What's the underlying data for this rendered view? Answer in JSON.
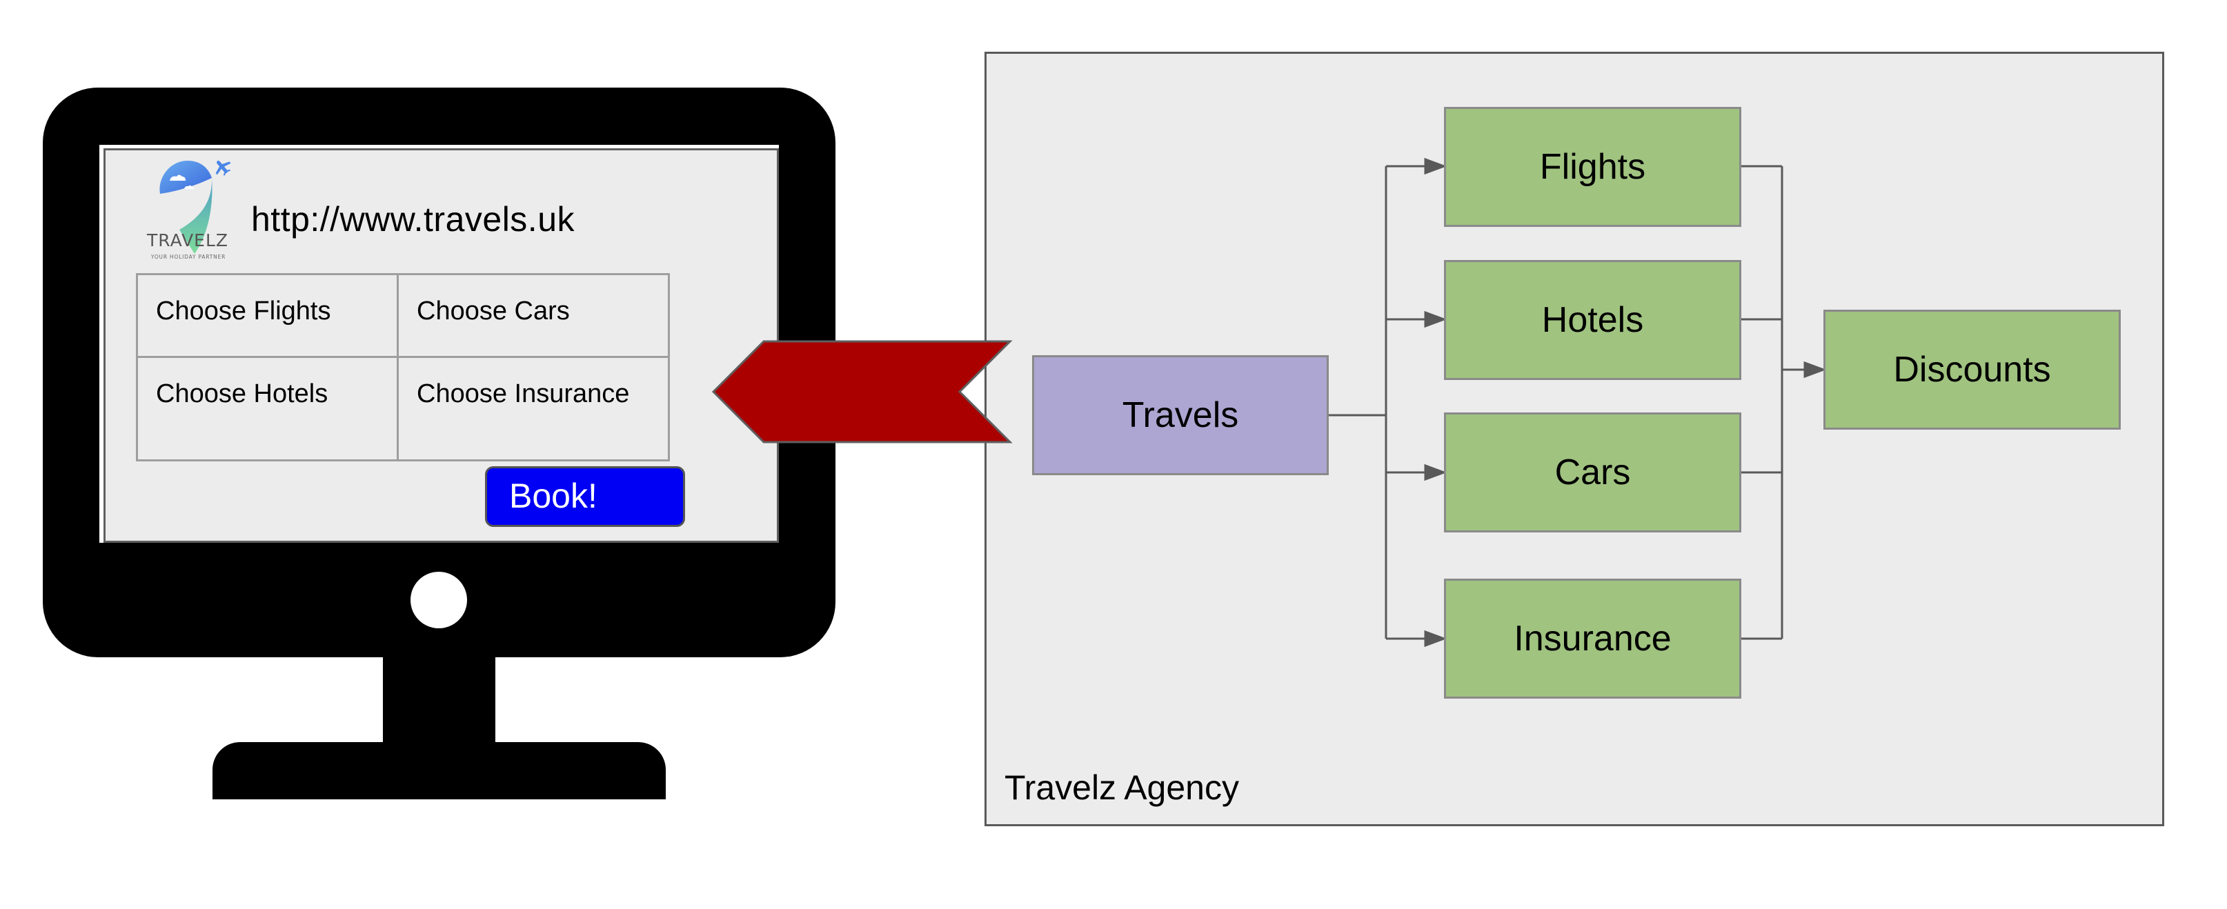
{
  "monitor": {
    "website": {
      "logo": {
        "icon": "travelz-pin-plane-logo",
        "brand": "TRAVELZ",
        "tagline": "YOUR HOLIDAY PARTNER"
      },
      "url": "http://www.travels.uk",
      "choices": [
        {
          "label": "Choose Flights"
        },
        {
          "label": "Choose Cars"
        },
        {
          "label": "Choose Hotels"
        },
        {
          "label": "Choose Insurance"
        }
      ],
      "book_button": "Book!"
    }
  },
  "connector_arrow": {
    "direction": "left",
    "from": "Travels",
    "to": "website",
    "color": "#aa0000"
  },
  "agency": {
    "label": "Travelz Agency",
    "root": {
      "label": "Travels",
      "color": "#ada6d2"
    },
    "services": [
      {
        "label": "Flights"
      },
      {
        "label": "Hotels"
      },
      {
        "label": "Cars"
      },
      {
        "label": "Insurance"
      }
    ],
    "aggregate": {
      "label": "Discounts"
    },
    "service_color": "#a0c380",
    "edges": [
      {
        "from": "Travels",
        "to": "Flights"
      },
      {
        "from": "Travels",
        "to": "Hotels"
      },
      {
        "from": "Travels",
        "to": "Cars"
      },
      {
        "from": "Travels",
        "to": "Insurance"
      },
      {
        "from": "Flights",
        "to": "Discounts"
      },
      {
        "from": "Hotels",
        "to": "Discounts"
      },
      {
        "from": "Cars",
        "to": "Discounts"
      },
      {
        "from": "Insurance",
        "to": "Discounts"
      }
    ]
  }
}
